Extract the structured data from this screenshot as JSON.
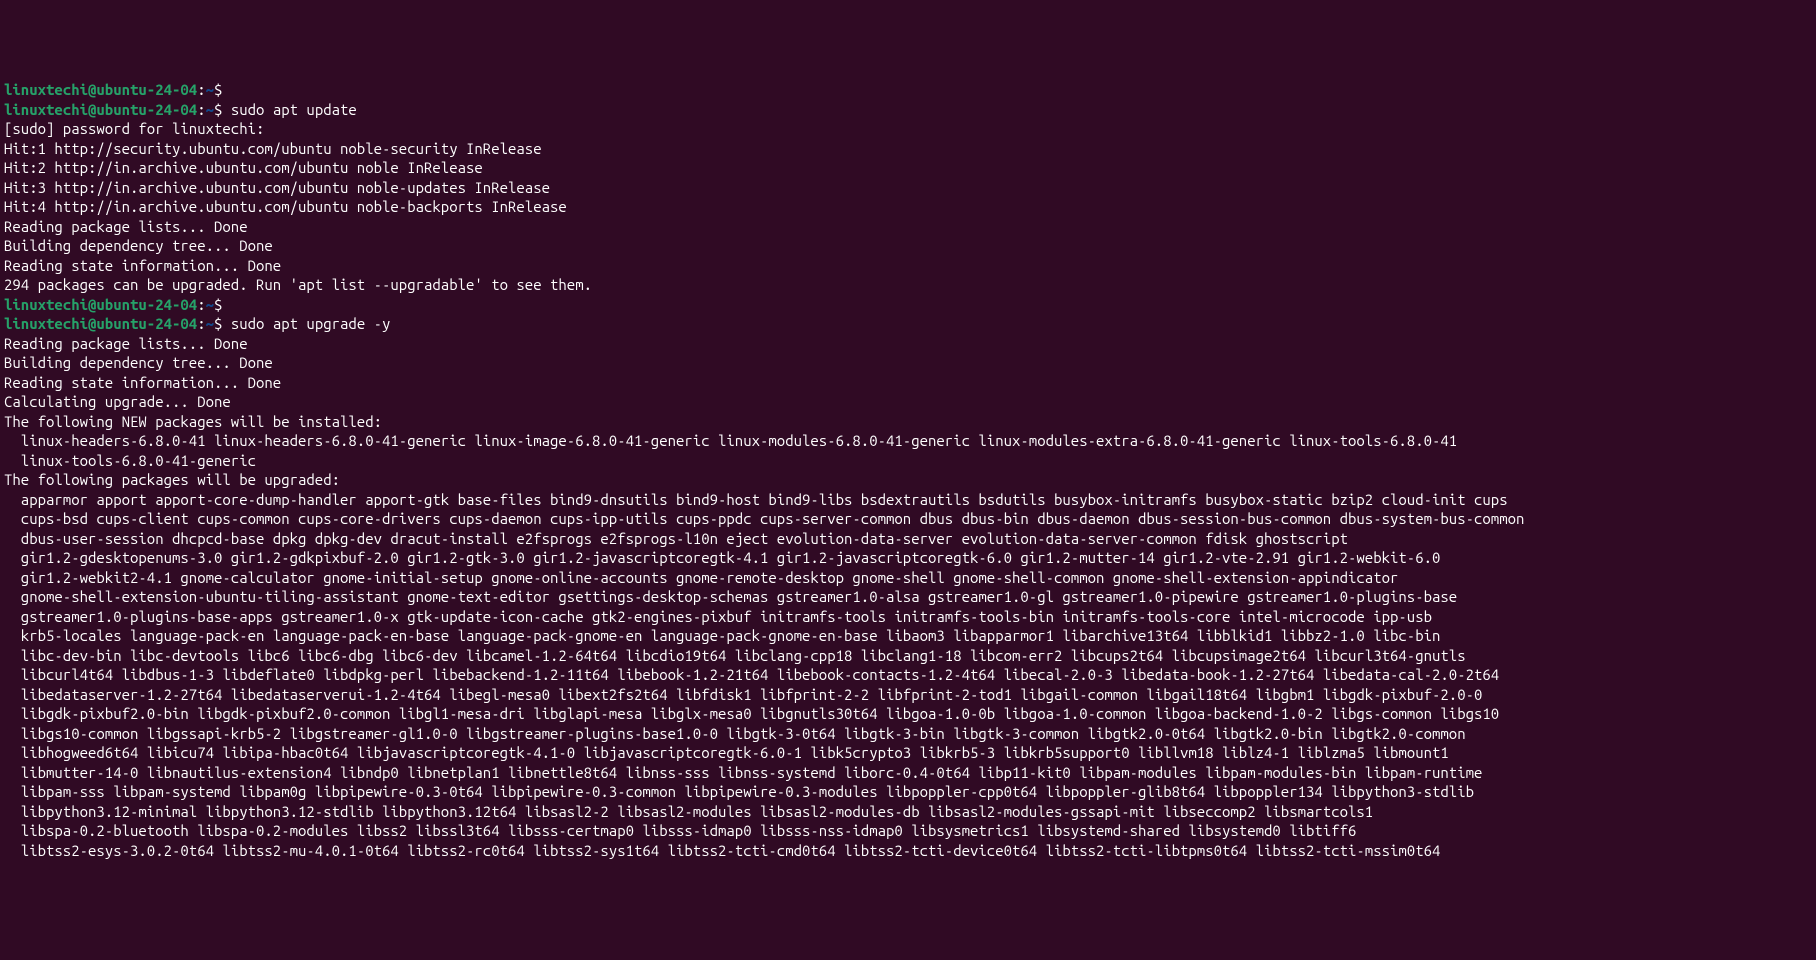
{
  "colors": {
    "background": "#300a24",
    "prompt_user": "#26a269",
    "prompt_path": "#12488b",
    "text": "#ffffff"
  },
  "prompt": {
    "user_host": "linuxtechi@ubuntu-24-04",
    "separator": ":",
    "path": "~",
    "symbol": "$"
  },
  "lines": [
    {
      "type": "prompt",
      "command": ""
    },
    {
      "type": "prompt",
      "command": "sudo apt update"
    },
    {
      "type": "output",
      "text": "[sudo] password for linuxtechi:"
    },
    {
      "type": "output",
      "text": "Hit:1 http://security.ubuntu.com/ubuntu noble-security InRelease"
    },
    {
      "type": "output",
      "text": "Hit:2 http://in.archive.ubuntu.com/ubuntu noble InRelease"
    },
    {
      "type": "output",
      "text": "Hit:3 http://in.archive.ubuntu.com/ubuntu noble-updates InRelease"
    },
    {
      "type": "output",
      "text": "Hit:4 http://in.archive.ubuntu.com/ubuntu noble-backports InRelease"
    },
    {
      "type": "output",
      "text": "Reading package lists... Done"
    },
    {
      "type": "output",
      "text": "Building dependency tree... Done"
    },
    {
      "type": "output",
      "text": "Reading state information... Done"
    },
    {
      "type": "output",
      "text": "294 packages can be upgraded. Run 'apt list --upgradable' to see them."
    },
    {
      "type": "prompt",
      "command": ""
    },
    {
      "type": "prompt",
      "command": "sudo apt upgrade -y"
    },
    {
      "type": "output",
      "text": "Reading package lists... Done"
    },
    {
      "type": "output",
      "text": "Building dependency tree... Done"
    },
    {
      "type": "output",
      "text": "Reading state information... Done"
    },
    {
      "type": "output",
      "text": "Calculating upgrade... Done"
    },
    {
      "type": "output",
      "text": "The following NEW packages will be installed:"
    },
    {
      "type": "indented",
      "text": "linux-headers-6.8.0-41 linux-headers-6.8.0-41-generic linux-image-6.8.0-41-generic linux-modules-6.8.0-41-generic linux-modules-extra-6.8.0-41-generic linux-tools-6.8.0-41"
    },
    {
      "type": "indented",
      "text": "linux-tools-6.8.0-41-generic"
    },
    {
      "type": "output",
      "text": "The following packages will be upgraded:"
    },
    {
      "type": "indented",
      "text": "apparmor apport apport-core-dump-handler apport-gtk base-files bind9-dnsutils bind9-host bind9-libs bsdextrautils bsdutils busybox-initramfs busybox-static bzip2 cloud-init cups"
    },
    {
      "type": "indented",
      "text": "cups-bsd cups-client cups-common cups-core-drivers cups-daemon cups-ipp-utils cups-ppdc cups-server-common dbus dbus-bin dbus-daemon dbus-session-bus-common dbus-system-bus-common"
    },
    {
      "type": "indented",
      "text": "dbus-user-session dhcpcd-base dpkg dpkg-dev dracut-install e2fsprogs e2fsprogs-l10n eject evolution-data-server evolution-data-server-common fdisk ghostscript"
    },
    {
      "type": "indented",
      "text": "gir1.2-gdesktopenums-3.0 gir1.2-gdkpixbuf-2.0 gir1.2-gtk-3.0 gir1.2-javascriptcoregtk-4.1 gir1.2-javascriptcoregtk-6.0 gir1.2-mutter-14 gir1.2-vte-2.91 gir1.2-webkit-6.0"
    },
    {
      "type": "indented",
      "text": "gir1.2-webkit2-4.1 gnome-calculator gnome-initial-setup gnome-online-accounts gnome-remote-desktop gnome-shell gnome-shell-common gnome-shell-extension-appindicator"
    },
    {
      "type": "indented",
      "text": "gnome-shell-extension-ubuntu-tiling-assistant gnome-text-editor gsettings-desktop-schemas gstreamer1.0-alsa gstreamer1.0-gl gstreamer1.0-pipewire gstreamer1.0-plugins-base"
    },
    {
      "type": "indented",
      "text": "gstreamer1.0-plugins-base-apps gstreamer1.0-x gtk-update-icon-cache gtk2-engines-pixbuf initramfs-tools initramfs-tools-bin initramfs-tools-core intel-microcode ipp-usb"
    },
    {
      "type": "indented",
      "text": "krb5-locales language-pack-en language-pack-en-base language-pack-gnome-en language-pack-gnome-en-base libaom3 libapparmor1 libarchive13t64 libblkid1 libbz2-1.0 libc-bin"
    },
    {
      "type": "indented",
      "text": "libc-dev-bin libc-devtools libc6 libc6-dbg libc6-dev libcamel-1.2-64t64 libcdio19t64 libclang-cpp18 libclang1-18 libcom-err2 libcups2t64 libcupsimage2t64 libcurl3t64-gnutls"
    },
    {
      "type": "indented",
      "text": "libcurl4t64 libdbus-1-3 libdeflate0 libdpkg-perl libebackend-1.2-11t64 libebook-1.2-21t64 libebook-contacts-1.2-4t64 libecal-2.0-3 libedata-book-1.2-27t64 libedata-cal-2.0-2t64"
    },
    {
      "type": "indented",
      "text": "libedataserver-1.2-27t64 libedataserverui-1.2-4t64 libegl-mesa0 libext2fs2t64 libfdisk1 libfprint-2-2 libfprint-2-tod1 libgail-common libgail18t64 libgbm1 libgdk-pixbuf-2.0-0"
    },
    {
      "type": "indented",
      "text": "libgdk-pixbuf2.0-bin libgdk-pixbuf2.0-common libgl1-mesa-dri libglapi-mesa libglx-mesa0 libgnutls30t64 libgoa-1.0-0b libgoa-1.0-common libgoa-backend-1.0-2 libgs-common libgs10"
    },
    {
      "type": "indented",
      "text": "libgs10-common libgssapi-krb5-2 libgstreamer-gl1.0-0 libgstreamer-plugins-base1.0-0 libgtk-3-0t64 libgtk-3-bin libgtk-3-common libgtk2.0-0t64 libgtk2.0-bin libgtk2.0-common"
    },
    {
      "type": "indented",
      "text": "libhogweed6t64 libicu74 libipa-hbac0t64 libjavascriptcoregtk-4.1-0 libjavascriptcoregtk-6.0-1 libk5crypto3 libkrb5-3 libkrb5support0 libllvm18 liblz4-1 liblzma5 libmount1"
    },
    {
      "type": "indented",
      "text": "libmutter-14-0 libnautilus-extension4 libndp0 libnetplan1 libnettle8t64 libnss-sss libnss-systemd liborc-0.4-0t64 libp11-kit0 libpam-modules libpam-modules-bin libpam-runtime"
    },
    {
      "type": "indented",
      "text": "libpam-sss libpam-systemd libpam0g libpipewire-0.3-0t64 libpipewire-0.3-common libpipewire-0.3-modules libpoppler-cpp0t64 libpoppler-glib8t64 libpoppler134 libpython3-stdlib"
    },
    {
      "type": "indented",
      "text": "libpython3.12-minimal libpython3.12-stdlib libpython3.12t64 libsasl2-2 libsasl2-modules libsasl2-modules-db libsasl2-modules-gssapi-mit libseccomp2 libsmartcols1"
    },
    {
      "type": "indented",
      "text": "libspa-0.2-bluetooth libspa-0.2-modules libss2 libssl3t64 libsss-certmap0 libsss-idmap0 libsss-nss-idmap0 libsysmetrics1 libsystemd-shared libsystemd0 libtiff6"
    },
    {
      "type": "indented",
      "text": "libtss2-esys-3.0.2-0t64 libtss2-mu-4.0.1-0t64 libtss2-rc0t64 libtss2-sys1t64 libtss2-tcti-cmd0t64 libtss2-tcti-device0t64 libtss2-tcti-libtpms0t64 libtss2-tcti-mssim0t64"
    }
  ]
}
